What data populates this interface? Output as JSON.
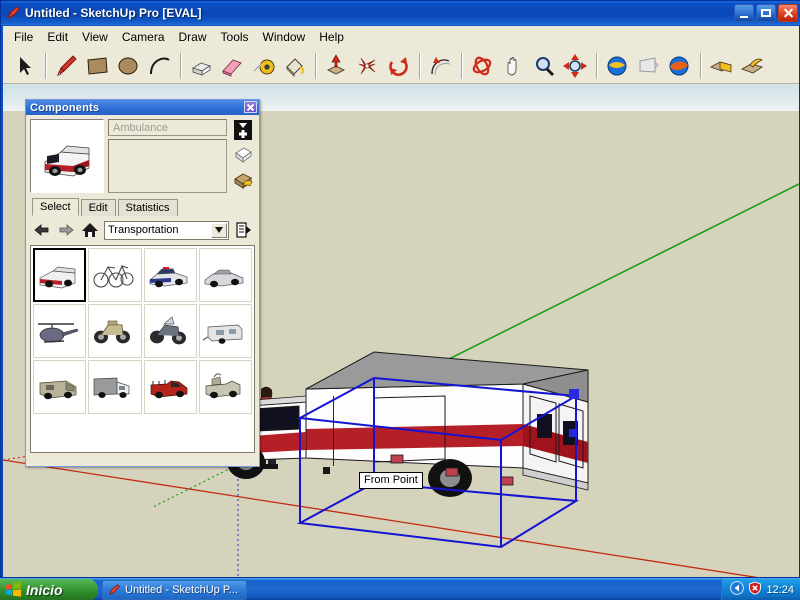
{
  "window": {
    "title": "Untitled - SketchUp Pro [EVAL]",
    "icon": "sketchup-pencil-icon",
    "minimize_label": "Minimize",
    "maximize_label": "Maximize",
    "close_label": "Close"
  },
  "menu": {
    "items": [
      {
        "label": "File"
      },
      {
        "label": "Edit"
      },
      {
        "label": "View"
      },
      {
        "label": "Camera"
      },
      {
        "label": "Draw"
      },
      {
        "label": "Tools"
      },
      {
        "label": "Window"
      },
      {
        "label": "Help"
      }
    ]
  },
  "toolbar": {
    "tools": [
      {
        "name": "select-arrow-tool",
        "tip": "Select"
      },
      {
        "name": "line-pencil-tool",
        "tip": "Line"
      },
      {
        "name": "rectangle-tool",
        "tip": "Rectangle"
      },
      {
        "name": "circle-tool",
        "tip": "Circle"
      },
      {
        "name": "arc-tool",
        "tip": "Arc"
      },
      {
        "name": "push-pull-tool",
        "tip": "Push/Pull"
      },
      {
        "name": "eraser-tool",
        "tip": "Eraser"
      },
      {
        "name": "tape-measure-tool",
        "tip": "Tape Measure"
      },
      {
        "name": "paint-bucket-tool",
        "tip": "Paint Bucket"
      },
      {
        "name": "move-tool",
        "tip": "Move"
      },
      {
        "name": "follow-me-tool",
        "tip": "Follow Me"
      },
      {
        "name": "rotate-tool",
        "tip": "Rotate"
      },
      {
        "name": "offset-tool",
        "tip": "Offset"
      },
      {
        "name": "orbit-tool",
        "tip": "Orbit"
      },
      {
        "name": "pan-tool",
        "tip": "Pan"
      },
      {
        "name": "zoom-tool",
        "tip": "Zoom"
      },
      {
        "name": "zoom-extents-tool",
        "tip": "Zoom Extents"
      },
      {
        "name": "add-location-tool",
        "tip": "Add Location"
      },
      {
        "name": "photo-texture-tool",
        "tip": "Photo Textures"
      },
      {
        "name": "preview-model-tool",
        "tip": "Preview Model in Google Earth"
      },
      {
        "name": "section-plane-tool",
        "tip": "Section Plane"
      },
      {
        "name": "display-section-tool",
        "tip": "Display Section Cuts"
      }
    ]
  },
  "components_panel": {
    "title": "Components",
    "close_label": "x",
    "preview": {
      "name": "ambulance-preview",
      "alt": "Ambulance component preview"
    },
    "name_field": {
      "value": "Ambulance",
      "placeholder": "Ambulance"
    },
    "description_field": {
      "value": "",
      "placeholder": ""
    },
    "side_buttons": [
      {
        "name": "insert-component-button",
        "tip": "Insert Component"
      },
      {
        "name": "display-secondary-pane-button",
        "tip": "Display Secondary Selection Pane"
      },
      {
        "name": "model-info-button",
        "tip": "Model Info"
      }
    ],
    "tabs": [
      {
        "label": "Select",
        "active": true
      },
      {
        "label": "Edit",
        "active": false
      },
      {
        "label": "Statistics",
        "active": false
      }
    ],
    "nav": {
      "back_label": "Back",
      "forward_label": "Forward",
      "home_label": "Home",
      "collection": "Transportation",
      "details_label": "Details"
    },
    "grid": [
      {
        "label": "Ambulance",
        "selected": true
      },
      {
        "label": "Bicycles",
        "selected": false
      },
      {
        "label": "Police Car",
        "selected": false
      },
      {
        "label": "Sedan",
        "selected": false
      },
      {
        "label": "Helicopter",
        "selected": false
      },
      {
        "label": "Motorcycle",
        "selected": false
      },
      {
        "label": "Police Motorcycle",
        "selected": false
      },
      {
        "label": "Travel Trailer",
        "selected": false
      },
      {
        "label": "Armored Truck",
        "selected": false
      },
      {
        "label": "Box Truck",
        "selected": false
      },
      {
        "label": "Red Pickup Truck",
        "selected": false
      },
      {
        "label": "Utility Truck",
        "selected": false
      }
    ]
  },
  "viewport": {
    "inference_tooltip": "From Point",
    "model": "ambulance-model",
    "scale_figure": "scale-figure-person",
    "colors": {
      "sky": "#dfeaec",
      "ground": "#d5d3bc",
      "selection_box": "#1414d2",
      "axis_green": "#13a013",
      "axis_red": "#c42a14",
      "body_white": "#fdfdfd",
      "body_red": "#b51f28",
      "roof_gray": "#9a9a9a"
    }
  },
  "taskbar": {
    "start_label": "Inicio",
    "items": [
      {
        "label": "Untitled - SketchUp P...",
        "icon": "sketchup-pencil-icon"
      }
    ],
    "tray": {
      "show_hidden_label": "<",
      "security_icon": "security-shield-icon",
      "clock": "12:24"
    }
  }
}
